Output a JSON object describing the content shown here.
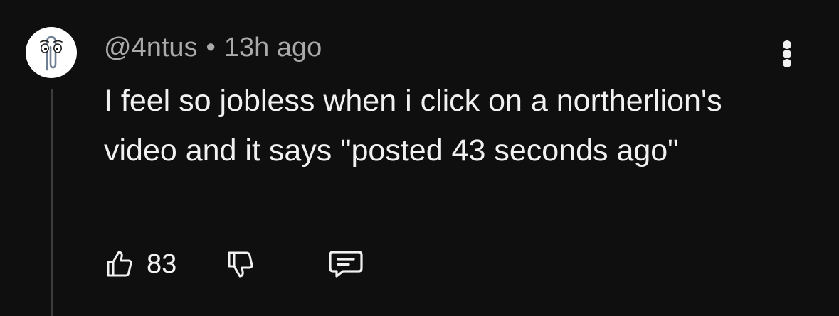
{
  "comment": {
    "author": "@4ntus",
    "separator": "•",
    "time": "13h ago",
    "text": "I feel so jobless when i click on a northerlion's video and it says \"posted 43 seconds ago\"",
    "likes": "83"
  },
  "icons": {
    "avatar": "paperclip-assistant-avatar",
    "more": "more-vert-icon",
    "like": "thumbs-up-icon",
    "dislike": "thumbs-down-icon",
    "reply": "reply-comment-icon"
  },
  "colors": {
    "background": "#0f0f0f",
    "primary_text": "#f1f1f1",
    "secondary_text": "#aaaaaa",
    "thread_line": "#3d3d3d"
  }
}
